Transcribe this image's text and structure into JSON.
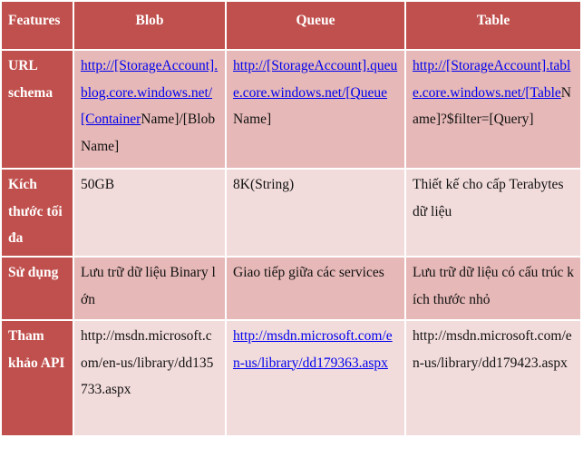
{
  "table": {
    "headers": [
      "Features",
      "Blob",
      "Queue",
      "Table"
    ],
    "rows": [
      {
        "feature": "URL schema",
        "blob": {
          "link": "http://[StorageAccount].blog.core.windows.net/[Container",
          "text": "Name]/[Blob Name]"
        },
        "queue": {
          "link": "http://[StorageAccount].queue.core.windows.net/[Queue",
          "text": "Name]"
        },
        "table": {
          "link": "http://[StorageAccount].table.core.windows.net/[Table",
          "text": "Name]?$filter=[Query]"
        }
      },
      {
        "feature": "Kích thước tối đa",
        "blob": "50GB",
        "queue": "8K(String)",
        "table": "Thiết kế cho cấp Terabytes dữ liệu"
      },
      {
        "feature": "Sử dụng",
        "blob": "Lưu trữ dữ liệu Binary lớn",
        "queue": "Giao tiếp giữa các services",
        "table": "Lưu trữ dữ liệu có cấu trúc kích thước nhỏ"
      },
      {
        "feature": "Tham khảo API",
        "blob": "http://msdn.microsoft.com/en-us/library/dd135733.aspx",
        "queue": {
          "link": "http://msdn.microsoft.com/en-us/library/dd179363.aspx"
        },
        "table": "http://msdn.microsoft.com/en-us/library/dd179423.aspx"
      }
    ]
  },
  "colors": {
    "header": "#c0504d",
    "row_dark": "#e6b8b7",
    "row_light": "#f2dcdb",
    "link": "#0000ee"
  }
}
